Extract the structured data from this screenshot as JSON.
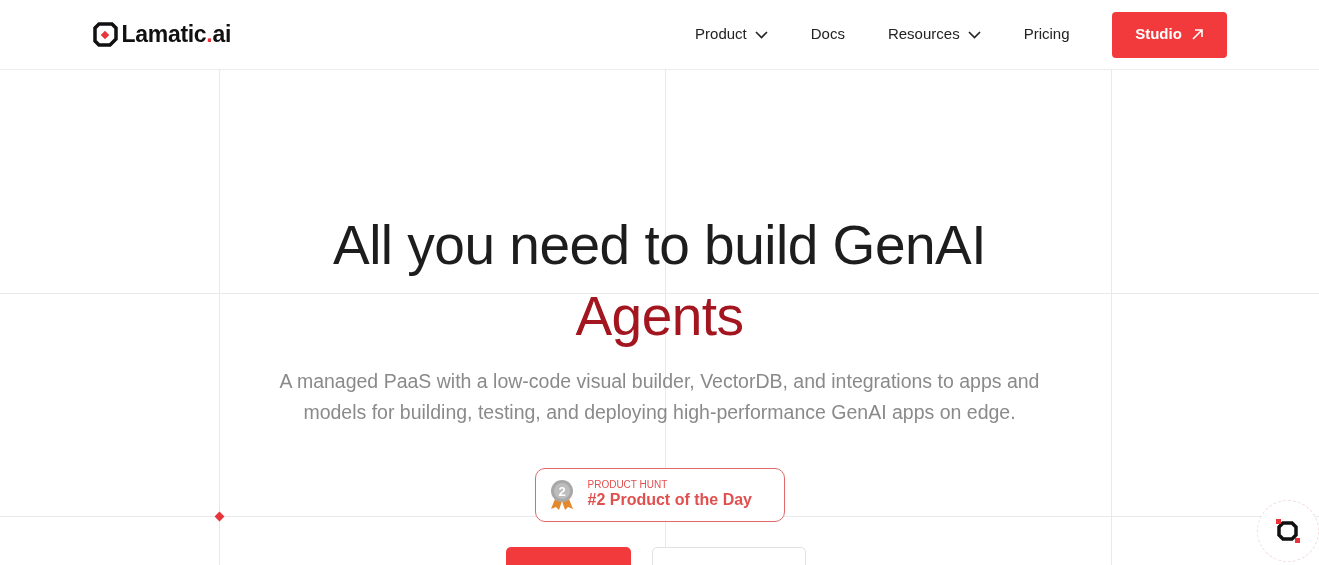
{
  "logo": {
    "name": "Lamatic",
    "dot": ".",
    "suffix": "ai"
  },
  "nav": [
    {
      "label": "Product",
      "has_dropdown": true
    },
    {
      "label": "Docs",
      "has_dropdown": false
    },
    {
      "label": "Resources",
      "has_dropdown": true
    },
    {
      "label": "Pricing",
      "has_dropdown": false
    }
  ],
  "cta": {
    "label": "Studio"
  },
  "hero": {
    "title": "All you need to build GenAI",
    "title_accent": "Agents",
    "subtitle": "A managed PaaS with a low-code visual builder, VectorDB, and integrations to apps and models for building, testing, and deploying high-performance GenAI apps on edge."
  },
  "award": {
    "medal_rank": "2",
    "label": "PRODUCT HUNT",
    "text": "#2 Product of the Day"
  }
}
